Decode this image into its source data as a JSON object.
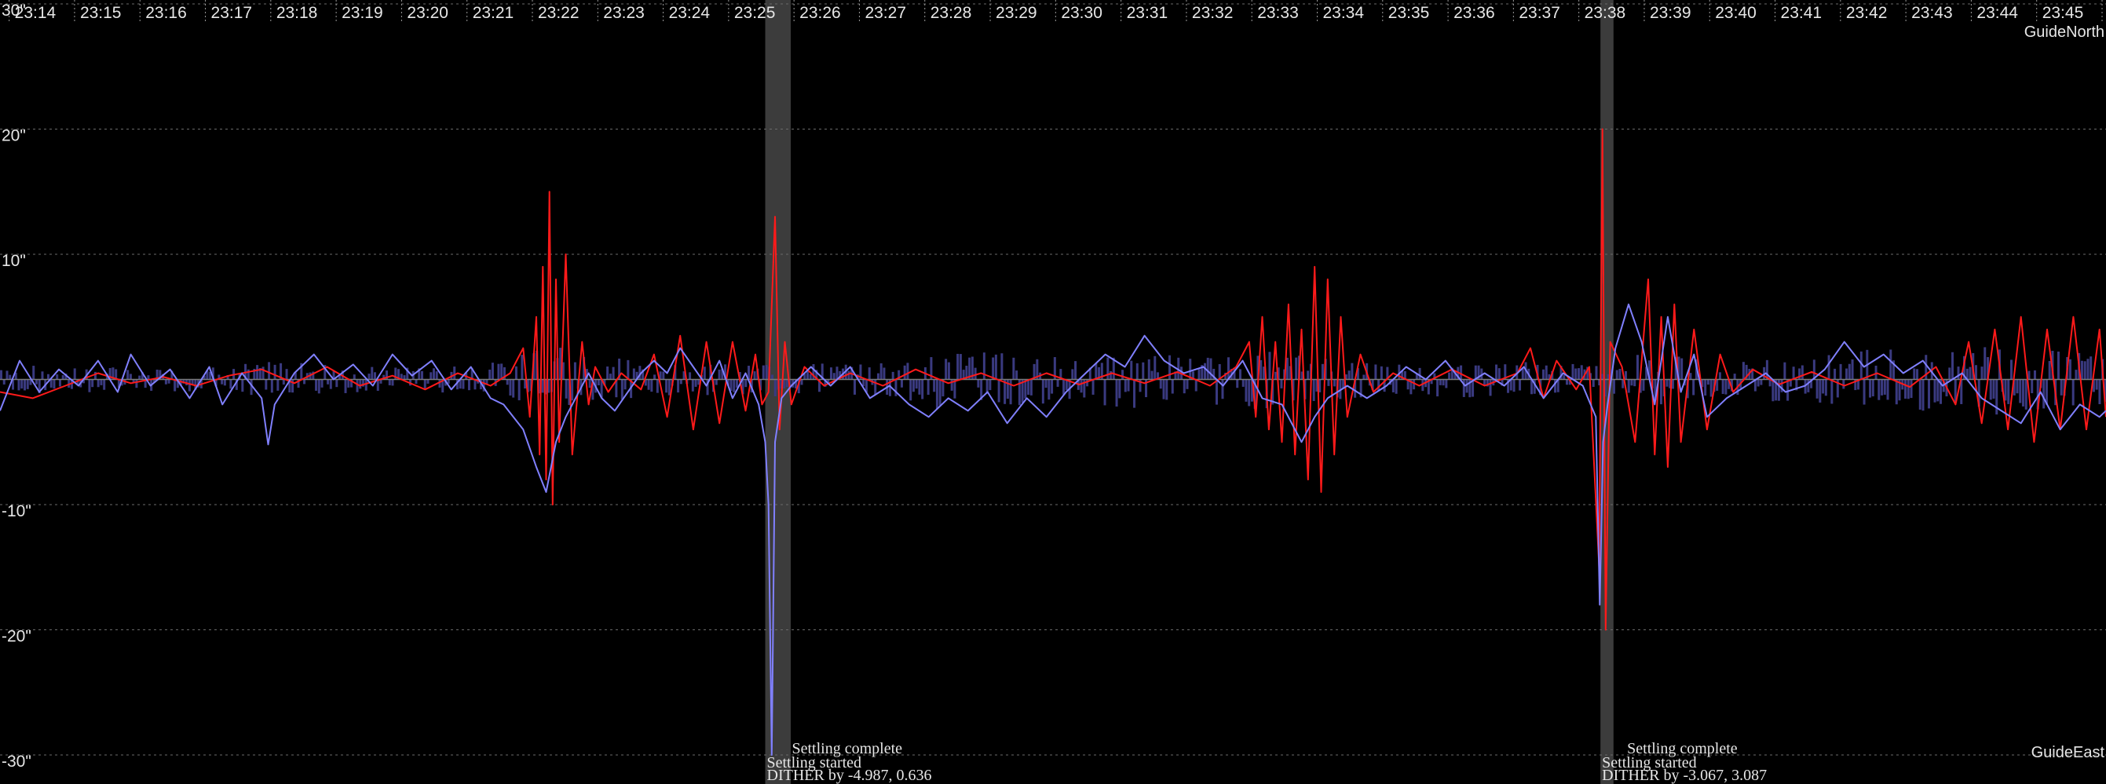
{
  "chart_data": {
    "type": "line",
    "x_ticks": [
      "23:14",
      "23:15",
      "23:16",
      "23:17",
      "23:18",
      "23:19",
      "23:20",
      "23:21",
      "23:22",
      "23:23",
      "23:24",
      "23:25",
      "23:26",
      "23:27",
      "23:28",
      "23:29",
      "23:30",
      "23:31",
      "23:32",
      "23:33",
      "23:34",
      "23:35",
      "23:36",
      "23:37",
      "23:38",
      "23:39",
      "23:40",
      "23:41",
      "23:42",
      "23:43",
      "23:44",
      "23:45",
      "23:4"
    ],
    "xlim": [
      13.8,
      46.0
    ],
    "ylim": [
      -30,
      30
    ],
    "y_ticks": [
      {
        "value": 30,
        "label": "30\""
      },
      {
        "value": 20,
        "label": "20\""
      },
      {
        "value": 10,
        "label": "10\""
      },
      {
        "value": -10,
        "label": "-10\""
      },
      {
        "value": -20,
        "label": "-20\""
      },
      {
        "value": -30,
        "label": "-30\""
      }
    ],
    "grid": true,
    "legend": {
      "top_right": "GuideNorth",
      "bottom_right": "GuideEast"
    },
    "colors": {
      "north": "#ff1a1a",
      "east": "#8080ff",
      "bars": "#3a3a80",
      "settle_band": "#3c3c3c",
      "zero_line": "#7a7a7a"
    },
    "settle_bands": [
      [
        25.5,
        25.89
      ],
      [
        38.27,
        38.47
      ]
    ],
    "annotations": [
      {
        "x": 25.5,
        "lines": [
          "Settling complete",
          "Settling started",
          "DITHER by -4.987, 0.636"
        ]
      },
      {
        "x": 38.27,
        "lines": [
          "Settling complete",
          "Settling started",
          "DITHER by -3.067, 3.087"
        ]
      }
    ],
    "series": [
      {
        "name": "GuideNorth",
        "key": "north",
        "points": [
          [
            13.8,
            -1
          ],
          [
            14.3,
            -1.5
          ],
          [
            14.8,
            -0.5
          ],
          [
            15.3,
            0.5
          ],
          [
            15.8,
            -0.3
          ],
          [
            16.3,
            0.2
          ],
          [
            16.8,
            -0.5
          ],
          [
            17.3,
            0.3
          ],
          [
            17.8,
            0.8
          ],
          [
            18.3,
            -0.3
          ],
          [
            18.8,
            1.0
          ],
          [
            19.3,
            -0.5
          ],
          [
            19.8,
            0.3
          ],
          [
            20.3,
            -0.8
          ],
          [
            20.8,
            0.5
          ],
          [
            21.3,
            -0.5
          ],
          [
            21.6,
            0.5
          ],
          [
            21.8,
            2.5
          ],
          [
            21.9,
            -3
          ],
          [
            22.0,
            5
          ],
          [
            22.05,
            -6
          ],
          [
            22.1,
            9
          ],
          [
            22.15,
            -8
          ],
          [
            22.2,
            15
          ],
          [
            22.25,
            -10
          ],
          [
            22.3,
            8
          ],
          [
            22.35,
            -5
          ],
          [
            22.45,
            10
          ],
          [
            22.55,
            -6
          ],
          [
            22.7,
            3
          ],
          [
            22.8,
            -2
          ],
          [
            22.9,
            1
          ],
          [
            23.1,
            -1
          ],
          [
            23.3,
            0.5
          ],
          [
            23.6,
            -0.8
          ],
          [
            23.8,
            2
          ],
          [
            24.0,
            -3
          ],
          [
            24.2,
            3.5
          ],
          [
            24.4,
            -4
          ],
          [
            24.6,
            3
          ],
          [
            24.8,
            -3.5
          ],
          [
            25.0,
            3
          ],
          [
            25.2,
            -2.5
          ],
          [
            25.35,
            2
          ],
          [
            25.45,
            -2
          ],
          [
            25.55,
            -1
          ],
          [
            25.65,
            13
          ],
          [
            25.72,
            -4
          ],
          [
            25.8,
            3
          ],
          [
            25.9,
            -2
          ],
          [
            26.1,
            1
          ],
          [
            26.4,
            -0.5
          ],
          [
            26.8,
            0.5
          ],
          [
            27.3,
            -0.5
          ],
          [
            27.8,
            0.8
          ],
          [
            28.3,
            -0.3
          ],
          [
            28.8,
            0.5
          ],
          [
            29.3,
            -0.5
          ],
          [
            29.8,
            0.5
          ],
          [
            30.3,
            -0.4
          ],
          [
            30.8,
            0.5
          ],
          [
            31.3,
            -0.3
          ],
          [
            31.8,
            0.6
          ],
          [
            32.3,
            -0.5
          ],
          [
            32.7,
            1
          ],
          [
            32.9,
            3
          ],
          [
            33.0,
            -3
          ],
          [
            33.1,
            5
          ],
          [
            33.2,
            -4
          ],
          [
            33.3,
            3
          ],
          [
            33.4,
            -5
          ],
          [
            33.5,
            6
          ],
          [
            33.6,
            -6
          ],
          [
            33.7,
            4
          ],
          [
            33.8,
            -8
          ],
          [
            33.9,
            9
          ],
          [
            34.0,
            -9
          ],
          [
            34.1,
            8
          ],
          [
            34.2,
            -6
          ],
          [
            34.3,
            5
          ],
          [
            34.4,
            -3
          ],
          [
            34.6,
            2
          ],
          [
            34.8,
            -1
          ],
          [
            35.1,
            0.5
          ],
          [
            35.5,
            -0.5
          ],
          [
            36.0,
            0.8
          ],
          [
            36.5,
            -0.5
          ],
          [
            37.0,
            0.5
          ],
          [
            37.2,
            2.5
          ],
          [
            37.4,
            -1.5
          ],
          [
            37.6,
            1.5
          ],
          [
            37.9,
            -0.8
          ],
          [
            38.1,
            1.0
          ],
          [
            38.25,
            -15
          ],
          [
            38.3,
            20
          ],
          [
            38.35,
            -20
          ],
          [
            38.42,
            3
          ],
          [
            38.6,
            1
          ],
          [
            38.8,
            -5
          ],
          [
            39.0,
            8
          ],
          [
            39.1,
            -6
          ],
          [
            39.2,
            5
          ],
          [
            39.3,
            -7
          ],
          [
            39.4,
            6
          ],
          [
            39.5,
            -5
          ],
          [
            39.7,
            4
          ],
          [
            39.9,
            -4
          ],
          [
            40.1,
            2
          ],
          [
            40.3,
            -1
          ],
          [
            40.6,
            0.8
          ],
          [
            41.0,
            -0.4
          ],
          [
            41.5,
            0.6
          ],
          [
            42.0,
            -0.5
          ],
          [
            42.5,
            0.5
          ],
          [
            43.0,
            -0.6
          ],
          [
            43.4,
            1
          ],
          [
            43.7,
            -2
          ],
          [
            43.9,
            3
          ],
          [
            44.1,
            -3.5
          ],
          [
            44.3,
            4
          ],
          [
            44.5,
            -4
          ],
          [
            44.7,
            5
          ],
          [
            44.9,
            -5
          ],
          [
            45.1,
            4
          ],
          [
            45.3,
            -4
          ],
          [
            45.5,
            5
          ],
          [
            45.7,
            -4
          ],
          [
            45.9,
            4
          ],
          [
            46.0,
            -3
          ]
        ]
      },
      {
        "name": "GuideEast",
        "key": "east",
        "points": [
          [
            13.8,
            -2.5
          ],
          [
            14.1,
            1.5
          ],
          [
            14.4,
            -1
          ],
          [
            14.7,
            0.8
          ],
          [
            15.0,
            -0.5
          ],
          [
            15.3,
            1.5
          ],
          [
            15.6,
            -1
          ],
          [
            15.8,
            2.0
          ],
          [
            16.1,
            -0.5
          ],
          [
            16.4,
            0.8
          ],
          [
            16.7,
            -1.5
          ],
          [
            17.0,
            1
          ],
          [
            17.2,
            -2
          ],
          [
            17.5,
            0.5
          ],
          [
            17.8,
            -1.5
          ],
          [
            17.9,
            -5.2
          ],
          [
            18.0,
            -2
          ],
          [
            18.3,
            0.5
          ],
          [
            18.6,
            2.0
          ],
          [
            18.9,
            0
          ],
          [
            19.2,
            1.2
          ],
          [
            19.5,
            -0.5
          ],
          [
            19.8,
            2
          ],
          [
            20.1,
            0.3
          ],
          [
            20.4,
            1.5
          ],
          [
            20.7,
            -0.8
          ],
          [
            21.0,
            1
          ],
          [
            21.3,
            -1.5
          ],
          [
            21.5,
            -2
          ],
          [
            21.8,
            -4
          ],
          [
            22.0,
            -7
          ],
          [
            22.15,
            -9
          ],
          [
            22.3,
            -5
          ],
          [
            22.45,
            -3
          ],
          [
            22.6,
            -1.5
          ],
          [
            22.8,
            0.5
          ],
          [
            23.0,
            -1.5
          ],
          [
            23.2,
            -2.5
          ],
          [
            23.4,
            -1
          ],
          [
            23.6,
            0.5
          ],
          [
            23.8,
            1.5
          ],
          [
            24.0,
            0.5
          ],
          [
            24.2,
            2.5
          ],
          [
            24.4,
            1
          ],
          [
            24.6,
            -0.5
          ],
          [
            24.8,
            1.5
          ],
          [
            25.0,
            -1.5
          ],
          [
            25.2,
            0.5
          ],
          [
            25.4,
            -2
          ],
          [
            25.5,
            -5
          ],
          [
            25.55,
            -10
          ],
          [
            25.6,
            -30
          ],
          [
            25.65,
            -5
          ],
          [
            25.75,
            -1.5
          ],
          [
            25.9,
            -0.5
          ],
          [
            26.2,
            1
          ],
          [
            26.5,
            -0.5
          ],
          [
            26.8,
            1
          ],
          [
            27.1,
            -1.5
          ],
          [
            27.4,
            -0.5
          ],
          [
            27.7,
            -2
          ],
          [
            28.0,
            -3
          ],
          [
            28.3,
            -1.5
          ],
          [
            28.6,
            -2.5
          ],
          [
            28.9,
            -1
          ],
          [
            29.2,
            -3.5
          ],
          [
            29.5,
            -1.5
          ],
          [
            29.8,
            -3
          ],
          [
            30.1,
            -1
          ],
          [
            30.4,
            0.5
          ],
          [
            30.7,
            2.0
          ],
          [
            31.0,
            1.0
          ],
          [
            31.3,
            3.5
          ],
          [
            31.6,
            1.5
          ],
          [
            31.9,
            0.5
          ],
          [
            32.2,
            1.0
          ],
          [
            32.5,
            -0.5
          ],
          [
            32.8,
            1.5
          ],
          [
            33.1,
            -1.5
          ],
          [
            33.4,
            -2
          ],
          [
            33.7,
            -5
          ],
          [
            33.9,
            -3
          ],
          [
            34.1,
            -1.5
          ],
          [
            34.4,
            -0.5
          ],
          [
            34.7,
            -1.5
          ],
          [
            35.0,
            -0.5
          ],
          [
            35.3,
            1.0
          ],
          [
            35.6,
            0
          ],
          [
            35.9,
            1.5
          ],
          [
            36.2,
            -0.5
          ],
          [
            36.5,
            0.5
          ],
          [
            36.8,
            -0.5
          ],
          [
            37.1,
            1
          ],
          [
            37.4,
            -1.5
          ],
          [
            37.7,
            0.5
          ],
          [
            38.0,
            -0.5
          ],
          [
            38.2,
            -3
          ],
          [
            38.26,
            -18
          ],
          [
            38.31,
            -5
          ],
          [
            38.38,
            -2
          ],
          [
            38.5,
            2.5
          ],
          [
            38.7,
            6
          ],
          [
            38.9,
            3
          ],
          [
            39.1,
            -2
          ],
          [
            39.3,
            5
          ],
          [
            39.5,
            -1
          ],
          [
            39.7,
            2
          ],
          [
            39.9,
            -3
          ],
          [
            40.2,
            -1.5
          ],
          [
            40.5,
            -0.5
          ],
          [
            40.8,
            0.5
          ],
          [
            41.1,
            -1
          ],
          [
            41.4,
            -0.5
          ],
          [
            41.7,
            0.8
          ],
          [
            42.0,
            3
          ],
          [
            42.3,
            1
          ],
          [
            42.6,
            2
          ],
          [
            42.9,
            0.5
          ],
          [
            43.2,
            1.5
          ],
          [
            43.5,
            -0.5
          ],
          [
            43.8,
            0.5
          ],
          [
            44.1,
            -1.5
          ],
          [
            44.4,
            -2.5
          ],
          [
            44.7,
            -3.5
          ],
          [
            45.0,
            -1
          ],
          [
            45.3,
            -4
          ],
          [
            45.6,
            -2
          ],
          [
            45.9,
            -3
          ],
          [
            46.0,
            -2.5
          ]
        ]
      },
      {
        "name": "corrections",
        "key": "bars",
        "bar_amplitude": [
          [
            13.8,
            1.0
          ],
          [
            16.0,
            0.8
          ],
          [
            18.0,
            1.2
          ],
          [
            20.0,
            0.8
          ],
          [
            21.5,
            1.2
          ],
          [
            22.0,
            3.0
          ],
          [
            22.5,
            2.0
          ],
          [
            23.0,
            1.5
          ],
          [
            24.0,
            1.2
          ],
          [
            25.0,
            1.0
          ],
          [
            26.0,
            1.2
          ],
          [
            27.0,
            1.0
          ],
          [
            28.0,
            2.0
          ],
          [
            29.0,
            2.0
          ],
          [
            30.0,
            1.5
          ],
          [
            31.0,
            2.0
          ],
          [
            32.0,
            1.5
          ],
          [
            33.0,
            2.0
          ],
          [
            34.0,
            1.5
          ],
          [
            35.0,
            1.0
          ],
          [
            36.0,
            1.2
          ],
          [
            37.0,
            1.2
          ],
          [
            38.0,
            1.0
          ],
          [
            39.0,
            1.8
          ],
          [
            40.0,
            1.2
          ],
          [
            41.0,
            1.5
          ],
          [
            42.0,
            2.0
          ],
          [
            43.0,
            2.0
          ],
          [
            44.0,
            2.5
          ],
          [
            45.0,
            2.0
          ],
          [
            46.0,
            1.8
          ]
        ]
      }
    ]
  }
}
